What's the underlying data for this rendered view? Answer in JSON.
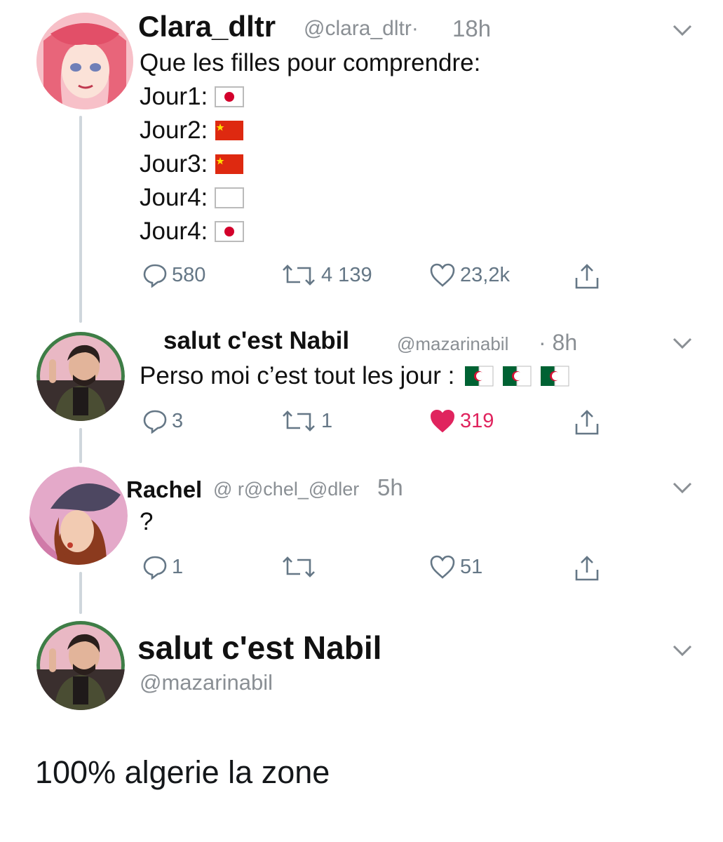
{
  "tweets": [
    {
      "name": "Clara_dltr",
      "handle": "@clara_dltr·",
      "time": "18h",
      "lines": [
        {
          "text": "Que les filles pour comprendre:",
          "flags": []
        },
        {
          "text": "Jour1:",
          "flags": [
            "japan"
          ]
        },
        {
          "text": "Jour2:",
          "flags": [
            "china"
          ]
        },
        {
          "text": "Jour3:",
          "flags": [
            "china"
          ]
        },
        {
          "text": "Jour4:",
          "flags": [
            "white"
          ]
        },
        {
          "text": "Jour4:",
          "flags": [
            "japan"
          ]
        }
      ],
      "replies": "580",
      "retweets": "4 139",
      "likes": "23,2k",
      "liked": false
    },
    {
      "name": "salut c'est Nabil",
      "handle": "@mazarinabil",
      "time": "· 8h",
      "text": "Perso moi c’est tout les jour :",
      "flags": [
        "algeria",
        "algeria",
        "algeria"
      ],
      "replies": "3",
      "retweets": "1",
      "likes": "319",
      "liked": true
    },
    {
      "name": "Rachel",
      "handle": "@ r@chel_@dler",
      "time": "5h",
      "text": "?",
      "replies": "1",
      "retweets": "",
      "likes": "51",
      "liked": false
    }
  ],
  "profile": {
    "name": "salut c'est Nabil",
    "handle": "@mazarinabil"
  },
  "final_text": "100% algerie la zone",
  "colors": {
    "text": "#14171a",
    "meta": "#8a8f94",
    "icon": "#657786",
    "like_red": "#e0245e",
    "thread_line": "#cfd6dc"
  },
  "icons": [
    "reply-icon",
    "retweet-icon",
    "like-icon",
    "share-icon",
    "chevron-down-icon"
  ]
}
